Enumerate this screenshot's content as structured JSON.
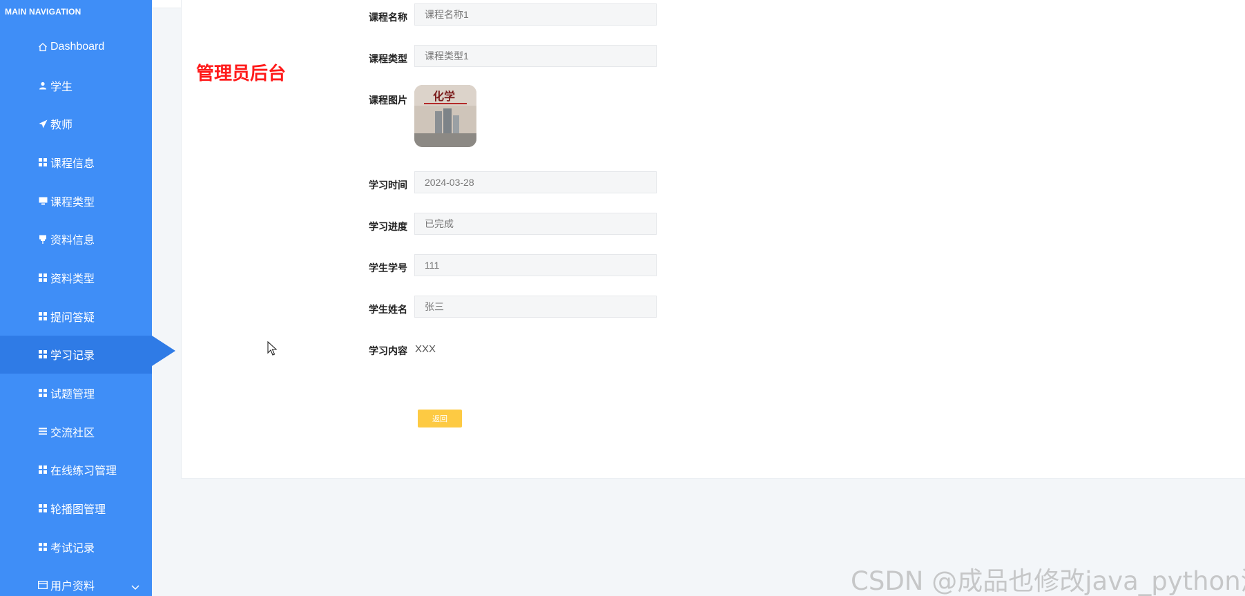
{
  "sidebar": {
    "header": "MAIN NAVIGATION",
    "items": [
      {
        "label": "Dashboard",
        "icon": "home-icon"
      },
      {
        "label": "学生",
        "icon": "user-icon"
      },
      {
        "label": "教师",
        "icon": "paper-plane-icon"
      },
      {
        "label": "课程信息",
        "icon": "grid-icon"
      },
      {
        "label": "课程类型",
        "icon": "monitor-icon"
      },
      {
        "label": "资料信息",
        "icon": "pushpin-icon"
      },
      {
        "label": "资料类型",
        "icon": "grid-icon"
      },
      {
        "label": "提问答疑",
        "icon": "grid-icon"
      },
      {
        "label": "学习记录",
        "icon": "grid-icon",
        "active": true
      },
      {
        "label": "试题管理",
        "icon": "grid-icon"
      },
      {
        "label": "交流社区",
        "icon": "list-icon"
      },
      {
        "label": "在线练习管理",
        "icon": "grid-icon"
      },
      {
        "label": "轮播图管理",
        "icon": "grid-icon"
      },
      {
        "label": "考试记录",
        "icon": "grid-icon"
      },
      {
        "label": "用户资料",
        "icon": "card-icon",
        "expandable": true
      }
    ]
  },
  "page": {
    "admin_title": "管理员后台",
    "image_text": "化学"
  },
  "form": {
    "course_name": {
      "label": "课程名称",
      "value": "课程名称1"
    },
    "course_type": {
      "label": "课程类型",
      "value": "课程类型1"
    },
    "course_image": {
      "label": "课程图片"
    },
    "study_time": {
      "label": "学习时间",
      "value": "2024-03-28"
    },
    "study_progress": {
      "label": "学习进度",
      "value": "已完成"
    },
    "student_id": {
      "label": "学生学号",
      "value": "111"
    },
    "student_name": {
      "label": "学生姓名",
      "value": "张三"
    },
    "study_content": {
      "label": "学习内容",
      "value": "XXX"
    }
  },
  "buttons": {
    "back": "返回"
  },
  "watermark": "CSDN @成品也修改java_python源码",
  "colors": {
    "sidebar": "#3f8ef7",
    "sidebar_active": "#2f7be6",
    "admin_title": "#ff1a1a",
    "back_button": "#fdca43"
  }
}
